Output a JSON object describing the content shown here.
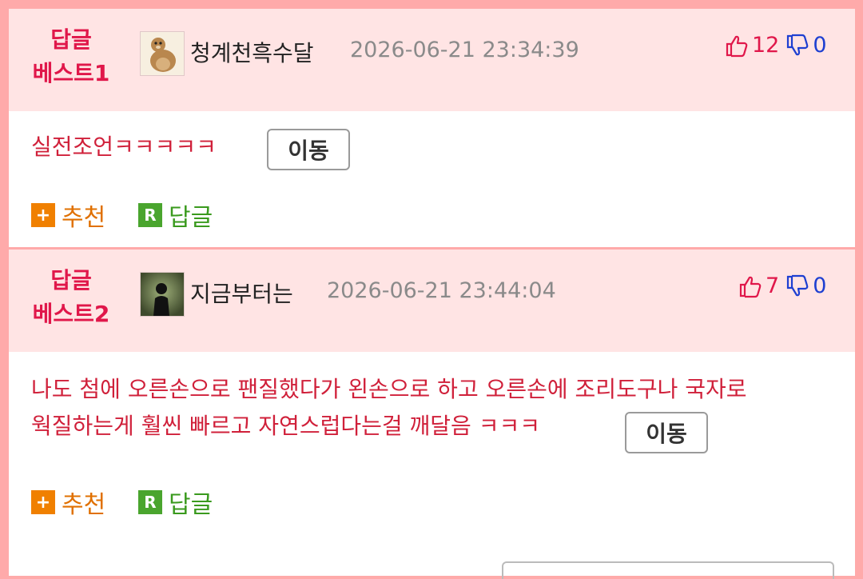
{
  "replies": [
    {
      "best_line1": "답글",
      "best_line2": "베스트1",
      "username": "청계천흑수달",
      "timestamp": "2026-06-21 23:34:39",
      "upvotes": "12",
      "downvotes": "0",
      "text_lines": [
        "실전조언ㅋㅋㅋㅋㅋ"
      ],
      "move_label": "이동",
      "recommend_label": "추천",
      "reply_label": "답글",
      "avatar_icon": "otter-avatar"
    },
    {
      "best_line1": "답글",
      "best_line2": "베스트2",
      "username": "지금부터는",
      "timestamp": "2026-06-21 23:44:04",
      "upvotes": "7",
      "downvotes": "0",
      "text_lines": [
        "나도 첨에 오른손으로 팬질했다가 왼손으로 하고 오른손에 조리도구나 국자로",
        "웍질하는게 훨씬 빠르고 자연스럽다는걸 깨달음 ㅋㅋㅋ"
      ],
      "move_label": "이동",
      "recommend_label": "추천",
      "reply_label": "답글",
      "avatar_icon": "dark-figure-avatar"
    }
  ],
  "badges": {
    "plus_glyph": "+",
    "reply_glyph": "R"
  },
  "colors": {
    "border": "#ffaaaa",
    "header_bg": "#ffe4e4",
    "accent_red": "#e0174a",
    "down_blue": "#1e3fd1"
  }
}
